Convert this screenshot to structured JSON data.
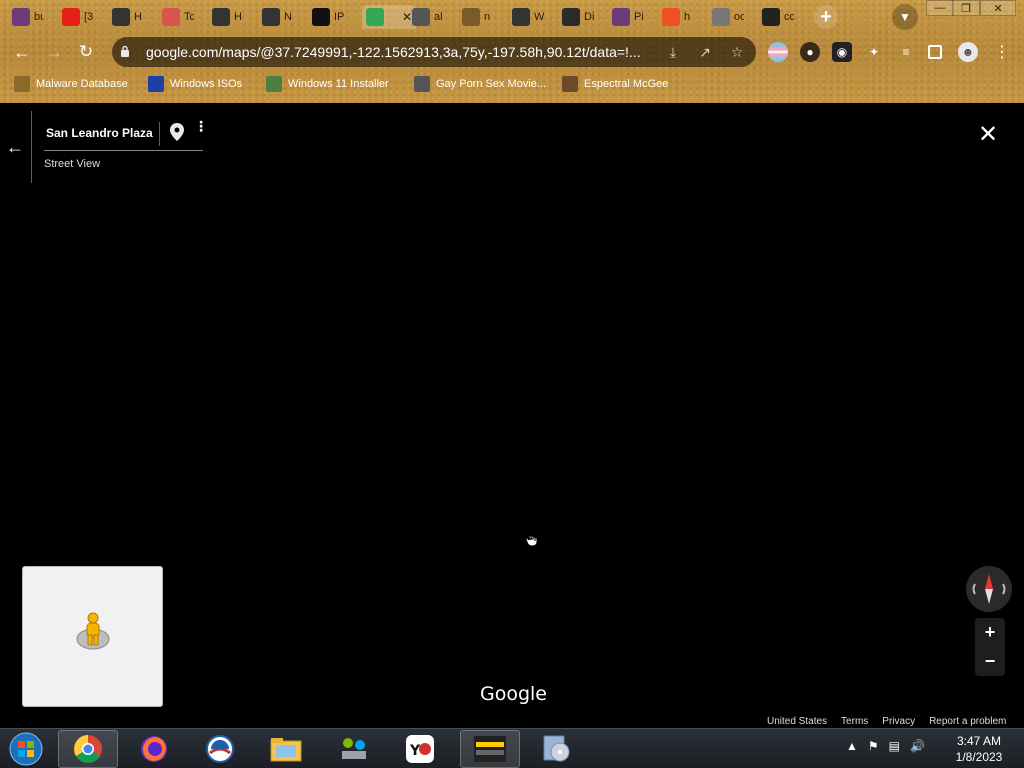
{
  "tabs": [
    {
      "label": "bu",
      "icon": "anime-avatar-icon",
      "color": "#6b3b7a"
    },
    {
      "label": "[3",
      "icon": "youtube-icon",
      "color": "#e62117"
    },
    {
      "label": "H",
      "icon": "incognito-icon",
      "color": "#333333"
    },
    {
      "label": "Tc",
      "icon": "calendar-icon",
      "color": "#d9534f"
    },
    {
      "label": "H",
      "icon": "incognito-icon",
      "color": "#333333"
    },
    {
      "label": "N",
      "icon": "incognito-icon",
      "color": "#333333"
    },
    {
      "label": "IP",
      "icon": "ip-icon",
      "color": "#111111"
    },
    {
      "label": "",
      "icon": "google-maps-icon",
      "color": "#34a853",
      "active": true
    },
    {
      "label": "al",
      "icon": "globe-icon",
      "color": "#555555"
    },
    {
      "label": "n",
      "icon": "cookie-icon",
      "color": "#7a5a2b"
    },
    {
      "label": "W",
      "icon": "museum-icon",
      "color": "#333333"
    },
    {
      "label": "Di",
      "icon": "vs-icon",
      "color": "#2b2b2b"
    },
    {
      "label": "Pi",
      "icon": "anime-avatar-icon",
      "color": "#6b3b7a"
    },
    {
      "label": "h",
      "icon": "windows-icon",
      "color": "#f25022"
    },
    {
      "label": "oc",
      "icon": "blank-circle-icon",
      "color": "#777777"
    },
    {
      "label": "cc",
      "icon": "wikipedia-icon",
      "color": "#222222"
    }
  ],
  "address_bar": {
    "url": "google.com/maps/@37.7249991,-122.1562913,3a,75y,-197.58h,90.12t/data=!..."
  },
  "bookmarks": [
    {
      "label": "Malware Database",
      "icon": "bookmark-icon"
    },
    {
      "label": "Windows ISOs",
      "icon": "x-logo-icon"
    },
    {
      "label": "Windows 11 Installer",
      "icon": "image-icon"
    },
    {
      "label": "Gay Porn Sex Movie...",
      "icon": "badge-icon"
    },
    {
      "label": "Espectral McGee",
      "icon": "avatar-icon"
    }
  ],
  "street_view": {
    "place_title": "San Leandro Plaza",
    "subtitle": "Street View",
    "logo": "Google",
    "footer": [
      "United States",
      "Terms",
      "Privacy",
      "Report a problem"
    ],
    "zoom_in": "+",
    "zoom_out": "−"
  },
  "taskbar": {
    "time": "3:47 AM",
    "date": "1/8/2023",
    "apps": [
      "start-orb",
      "chrome",
      "firefox",
      "obama-app",
      "file-explorer",
      "network-app",
      "y8-app",
      "warning-app",
      "disc-app"
    ]
  },
  "colors": {
    "accent_gold": "#c2923c",
    "map_bg": "#000000",
    "taskbar": "#1b1f24"
  }
}
